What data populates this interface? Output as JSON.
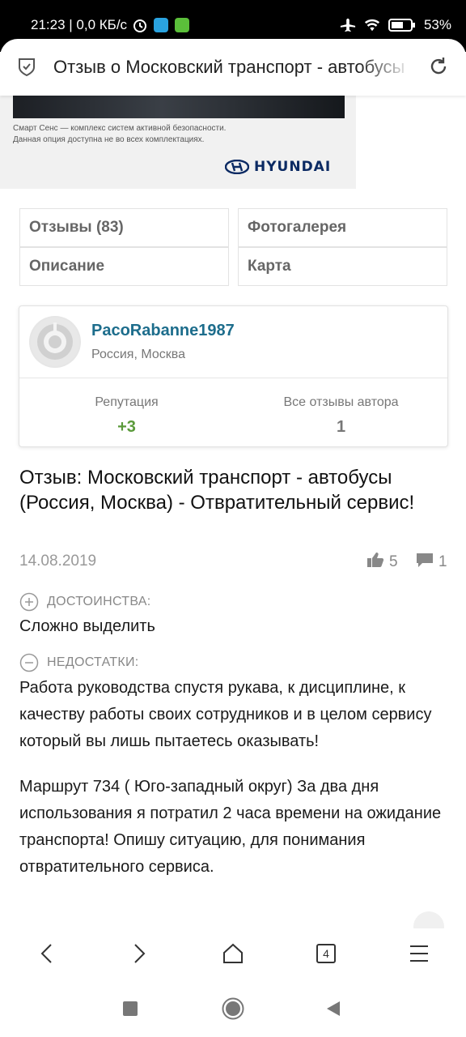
{
  "status_bar": {
    "time_speed": "21:23 | 0,0 КБ/с",
    "battery": "53%",
    "icons": [
      "alarm-icon",
      "telegram-icon",
      "download-icon",
      "airplane-icon",
      "wifi-icon",
      "battery-icon"
    ]
  },
  "browser": {
    "page_title": "Отзыв о Московский транспорт - автобусы",
    "icons": [
      "shield-icon",
      "reload-icon"
    ]
  },
  "ad": {
    "line1": "Смарт Сенс — комплекс систем активной безопасности.",
    "line2": "Данная опция доступна не во всех комплектациях.",
    "brand": "HYUNDAI"
  },
  "tabs": {
    "reviews": "Отзывы (83)",
    "gallery": "Фотогалерея",
    "description": "Описание",
    "map": "Карта"
  },
  "author": {
    "name": "PacoRabanne1987",
    "location": "Россия, Москва",
    "reputation_label": "Репутация",
    "reputation_value": "+3",
    "reviews_label": "Все отзывы автора",
    "reviews_value": "1"
  },
  "review": {
    "title": "Отзыв: Московский транспорт - автобусы (Россия, Москва) - Отвратительный сервис!",
    "date": "14.08.2019",
    "likes": "5",
    "comments": "1",
    "pros_label": "ДОСТОИНСТВА:",
    "pros_text": "Сложно выделить",
    "cons_label": "НЕДОСТАТКИ:",
    "cons_text": "Работа руководства спустя рукава, к дисциплине, к качеству работы своих сотрудников и в целом сервису который вы лишь пытаетесь оказывать!",
    "body_text": "Маршрут 734 ( Юго-западный округ) За два дня использования я потратил 2 часа времени на ожидание транспорта! Опишу ситуацию, для понимания отвратительного сервиса."
  },
  "nav": {
    "tabs_count": "4",
    "icons": [
      "back-icon",
      "forward-icon",
      "home-icon",
      "tabs-icon",
      "menu-icon"
    ]
  },
  "colors": {
    "author_link": "#1d6d8c",
    "reputation": "#5a9a3a",
    "status_bar": "#000000"
  }
}
